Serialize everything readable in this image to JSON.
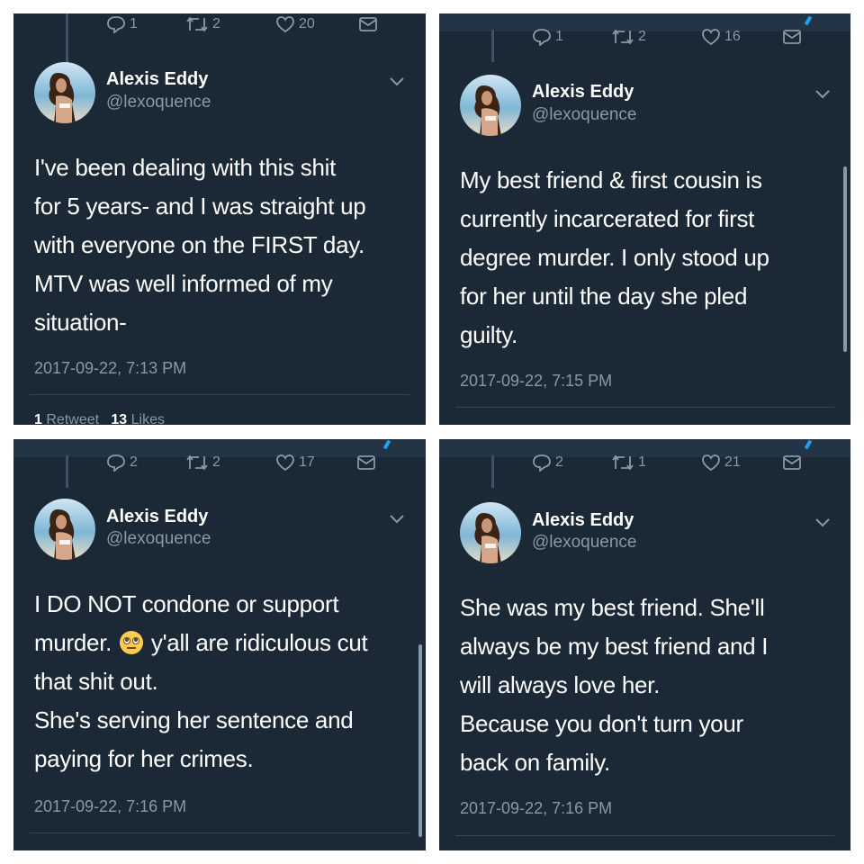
{
  "tweets": [
    {
      "name": "Alexis Eddy",
      "handle": "@lexoquence",
      "actions": {
        "reply": "1",
        "retweet": "2",
        "like": "20"
      },
      "text_lines": [
        "I've been dealing with this shit",
        "for 5 years- and I was straight up",
        "with everyone on the FIRST day.",
        "MTV was well informed of my",
        "situation-"
      ],
      "timestamp": "2017-09-22, 7:13 PM",
      "stats": {
        "retweets": "1",
        "retweets_label": "Retweet",
        "likes": "13",
        "likes_label": "Likes"
      }
    },
    {
      "name": "Alexis Eddy",
      "handle": "@lexoquence",
      "actions": {
        "reply": "1",
        "retweet": "2",
        "like": "16"
      },
      "text_lines": [
        "My best friend & first cousin is",
        "currently incarcerated for first",
        "degree murder. I only stood up",
        "for her until the day she pled",
        "guilty."
      ],
      "timestamp": "2017-09-22, 7:15 PM"
    },
    {
      "name": "Alexis Eddy",
      "handle": "@lexoquence",
      "actions": {
        "reply": "2",
        "retweet": "2",
        "like": "17"
      },
      "text_line1_before": "I DO NOT condone or support",
      "text_line2_before": "murder.",
      "text_line2_after": "y'all are ridiculous cut",
      "text_rest": [
        "that shit out.",
        "She's serving her sentence and",
        "paying for her crimes."
      ],
      "timestamp": "2017-09-22, 7:16 PM"
    },
    {
      "name": "Alexis Eddy",
      "handle": "@lexoquence",
      "actions": {
        "reply": "2",
        "retweet": "1",
        "like": "21"
      },
      "text_lines": [
        "She was my best friend. She'll",
        "always be my best friend and I",
        "will always love her.",
        "Because you don't turn your",
        "back on family."
      ],
      "timestamp": "2017-09-22, 7:16 PM"
    }
  ],
  "icons": [
    "reply-icon",
    "retweet-icon",
    "like-icon",
    "message-icon",
    "chevron-down-icon",
    "rolling-eyes-emoji"
  ],
  "colors": {
    "background": "#1b2836",
    "text": "#ffffff",
    "muted": "#8899a6",
    "accent": "#1da1f2"
  }
}
